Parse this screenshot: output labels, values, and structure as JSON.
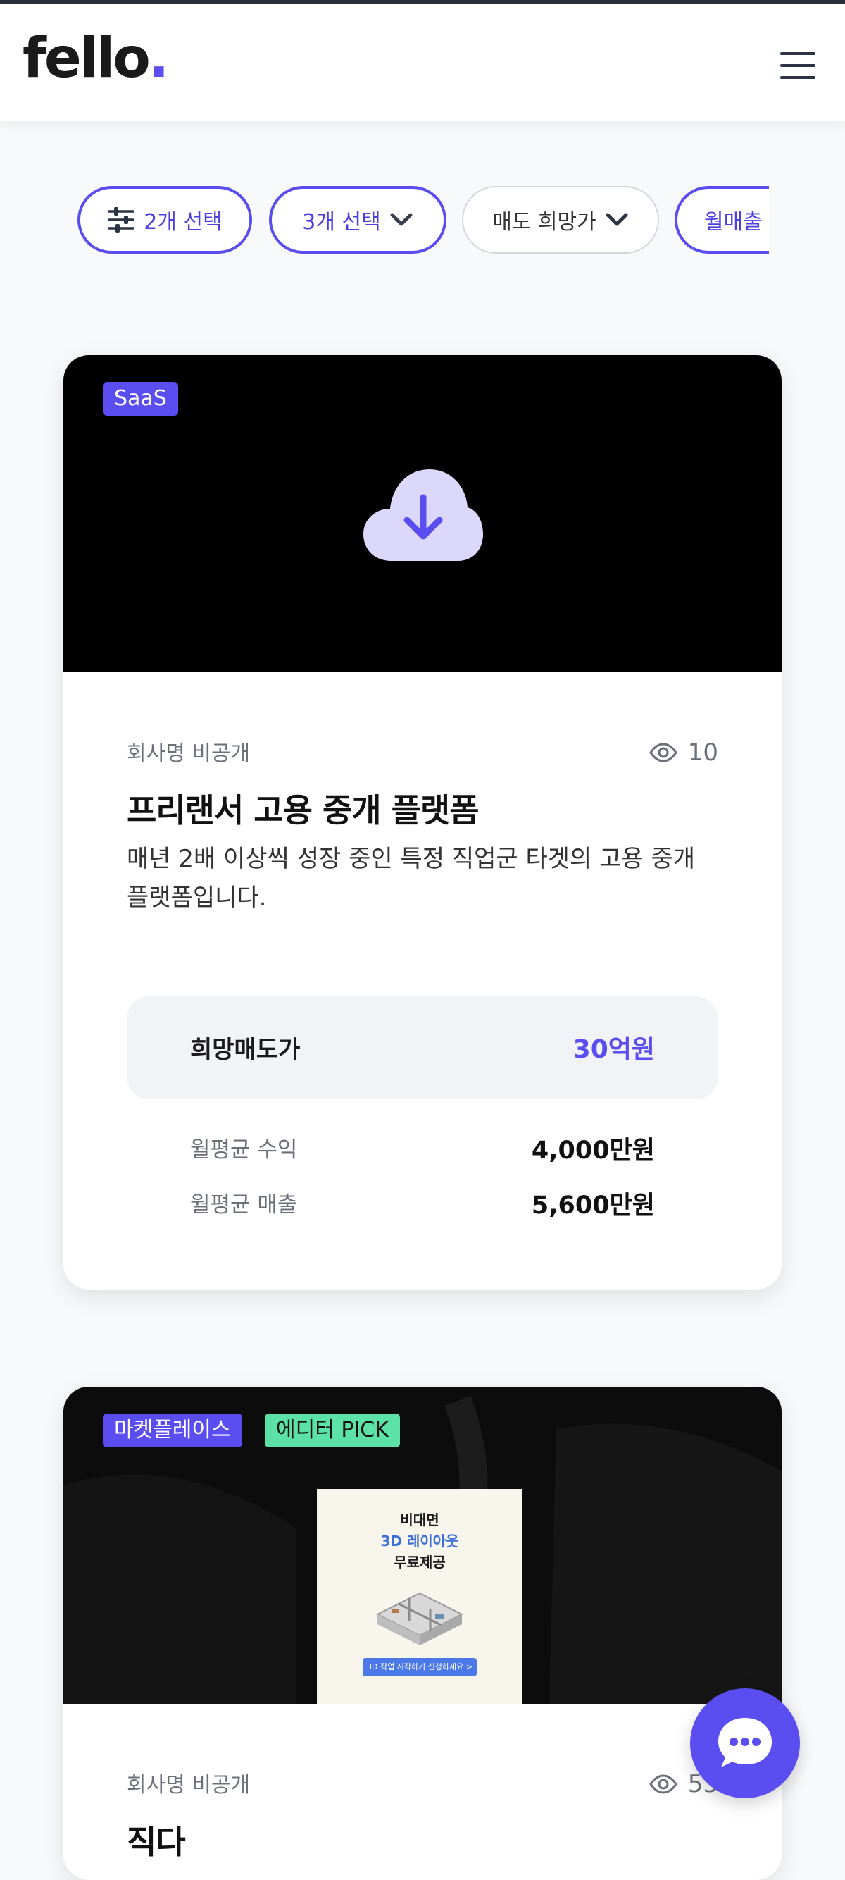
{
  "header": {
    "logo_text": "fello",
    "logo_dot": ".",
    "menu_icon": "hamburger-menu-icon"
  },
  "filters": [
    {
      "label": "2개 선택",
      "icon": "sliders-icon",
      "active": true
    },
    {
      "label": "3개 선택",
      "icon": "chevron-down-icon",
      "active": true
    },
    {
      "label": "매도 희망가",
      "icon": "chevron-down-icon",
      "active": false
    },
    {
      "label": "월매출",
      "icon": "chevron-down-icon",
      "active": true
    }
  ],
  "listings": [
    {
      "badges": [
        "SaaS"
      ],
      "thumbnail_icon": "cloud-download-icon",
      "company": "회사명 비공개",
      "views": "10",
      "title": "프리랜서 고용 중개 플랫폼",
      "description": "매년 2배 이상씩 성장 중인 특정 직업군 타겟의 고용 중개 플랫폼입니다.",
      "price_label": "희망매도가",
      "price_value": "30억원",
      "stats": [
        {
          "label": "월평균 수익",
          "value": "4,000만원"
        },
        {
          "label": "월평균 매출",
          "value": "5,600만원"
        }
      ]
    },
    {
      "badges": [
        "마켓플레이스",
        "에디터 PICK"
      ],
      "poster": {
        "line1": "비대면",
        "line2": "3D 레이아웃",
        "line3": "무료제공",
        "cta": "3D 작업 시작하기 신청하세요 >"
      },
      "company": "회사명 비공개",
      "views": "53",
      "title": "직다"
    }
  ],
  "chat_button_icon": "chat-bubble-icon",
  "colors": {
    "accent": "#5b4ef0",
    "green_badge": "#5ce2a6",
    "price_box": "#f2f3f6"
  }
}
